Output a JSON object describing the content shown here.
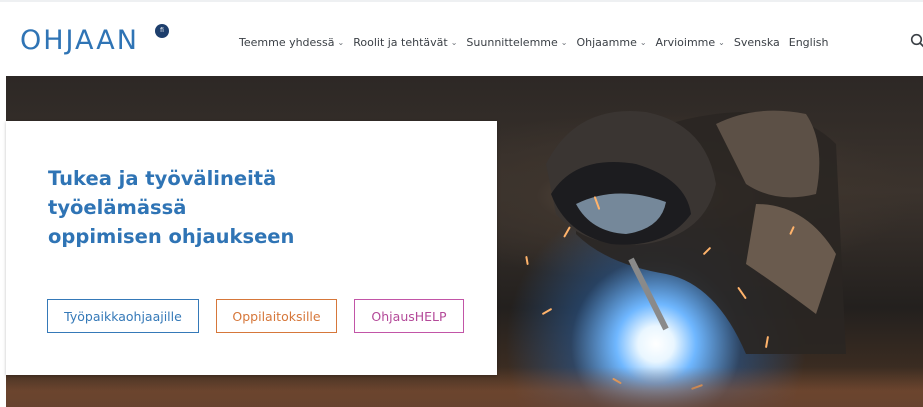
{
  "header": {
    "logo_text": "OHJAAN",
    "logo_badge": "fi",
    "nav": [
      {
        "label": "Teemme yhdessä",
        "has_dropdown": true
      },
      {
        "label": "Roolit ja tehtävät",
        "has_dropdown": true
      },
      {
        "label": "Suunnittelemme",
        "has_dropdown": true
      },
      {
        "label": "Ohjaamme",
        "has_dropdown": true
      },
      {
        "label": "Arvioimme",
        "has_dropdown": true
      },
      {
        "label": "Svenska",
        "has_dropdown": false
      },
      {
        "label": "English",
        "has_dropdown": false
      }
    ],
    "search_icon": "search-icon"
  },
  "hero": {
    "image": "welder-with-sparks",
    "title_lines": [
      "Tukea ja työvälineitä",
      "työelämässä",
      "oppimisen ohjaukseen"
    ],
    "buttons": [
      {
        "label": "Työpaikkaohjaajille",
        "color": "#3579b8"
      },
      {
        "label": "Oppilaitoksille",
        "color": "#d6773a"
      },
      {
        "label": "OhjausHELP",
        "color": "#c255a7"
      }
    ]
  },
  "colors": {
    "brand_blue": "#2f74b5",
    "logo_badge": "#1e3f6d"
  }
}
